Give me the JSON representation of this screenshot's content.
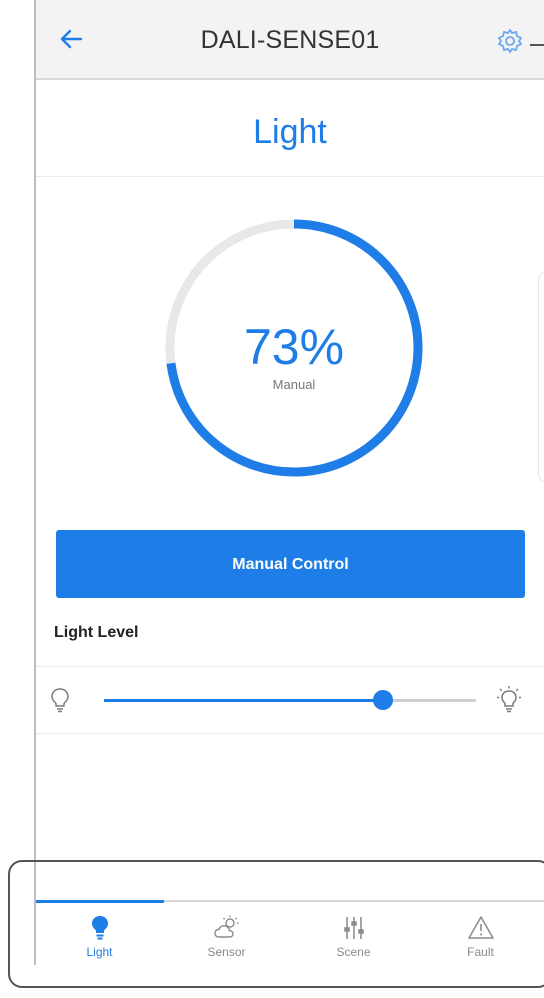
{
  "header": {
    "title": "DALI-SENSE01"
  },
  "page": {
    "heading": "Light"
  },
  "status": {
    "level_text": "73%",
    "level_fraction": 0.73,
    "mode": "Manual"
  },
  "controls": {
    "manual_button_label": "Manual Control",
    "light_level_label": "Light Level",
    "slider_fraction": 0.75
  },
  "tabs": [
    {
      "label": "Light",
      "icon": "bulb-icon",
      "active": true
    },
    {
      "label": "Sensor",
      "icon": "weather-icon",
      "active": false
    },
    {
      "label": "Scene",
      "icon": "sliders-icon",
      "active": false
    },
    {
      "label": "Fault",
      "icon": "warning-icon",
      "active": false
    }
  ],
  "colors": {
    "accent": "#1e7de6",
    "track": "#e8e8e8",
    "inactive": "#8a8a8a"
  }
}
